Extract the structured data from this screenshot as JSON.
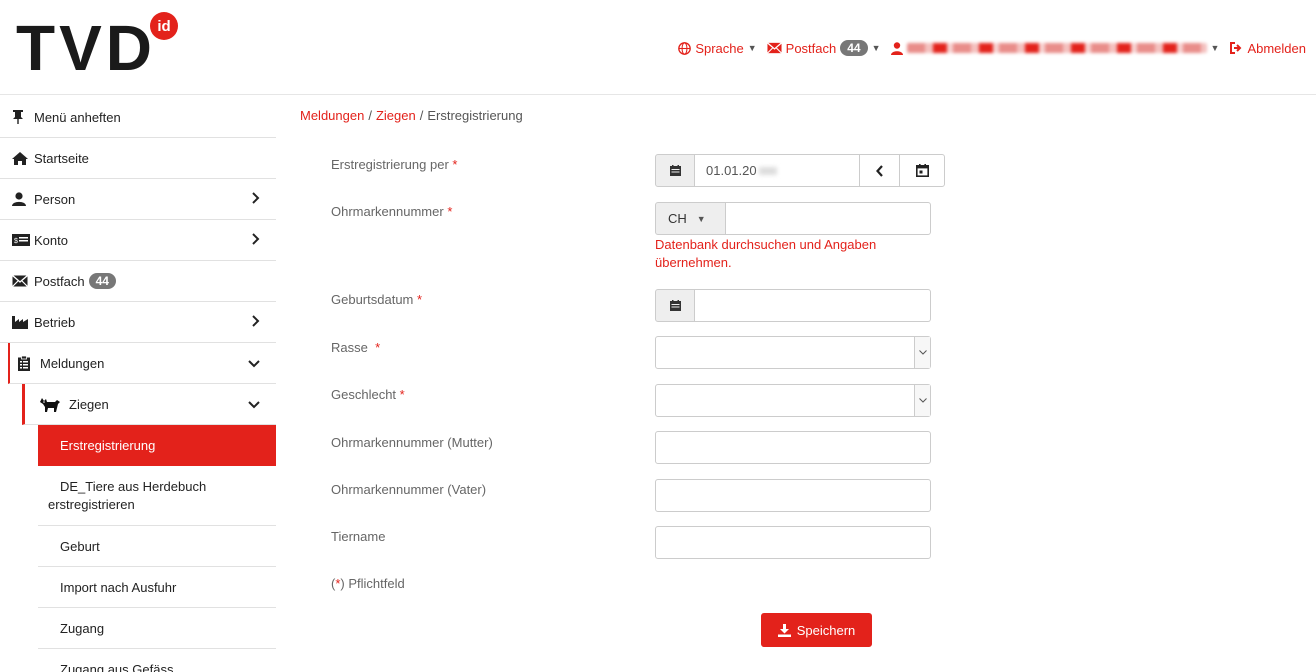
{
  "header": {
    "logo_text": "TVD",
    "logo_badge": "id",
    "language": "Sprache",
    "mailbox": "Postfach",
    "mailbox_count": "44",
    "logout": "Abmelden"
  },
  "sidebar": {
    "pin": "Menü anheften",
    "home": "Startseite",
    "person": "Person",
    "account": "Konto",
    "mailbox": "Postfach",
    "mailbox_count": "44",
    "farm": "Betrieb",
    "reports": "Meldungen",
    "goats": "Ziegen",
    "sub_items": {
      "first_registration": "Erstregistrierung",
      "de_herdbook_line1": "DE_Tiere aus Herdebuch",
      "de_herdbook_line2": "erstregistrieren",
      "birth": "Geburt",
      "import_after_export": "Import nach Ausfuhr",
      "entry": "Zugang",
      "entry_from_vessel": "Zugang aus Gefäss"
    }
  },
  "breadcrumb": {
    "level1": "Meldungen",
    "level2": "Ziegen",
    "current": "Erstregistrierung"
  },
  "form": {
    "registration_date_label": "Erstregistrierung per",
    "registration_date_value": "01.01.20",
    "ear_tag_label": "Ohrmarkennummer",
    "country_code": "CH",
    "search_hint": "Datenbank durchsuchen und Angaben übernehmen.",
    "birth_date_label": "Geburtsdatum",
    "breed_label": "Rasse",
    "sex_label": "Geschlecht",
    "mother_tag_label": "Ohrmarkennummer (Mutter)",
    "father_tag_label": "Ohrmarkennummer (Vater)",
    "animal_name_label": "Tiername",
    "required_note": "Pflichtfeld",
    "required_star": "*",
    "save_button": "Speichern"
  },
  "colors": {
    "accent": "#e3221b",
    "badge": "#777777"
  }
}
